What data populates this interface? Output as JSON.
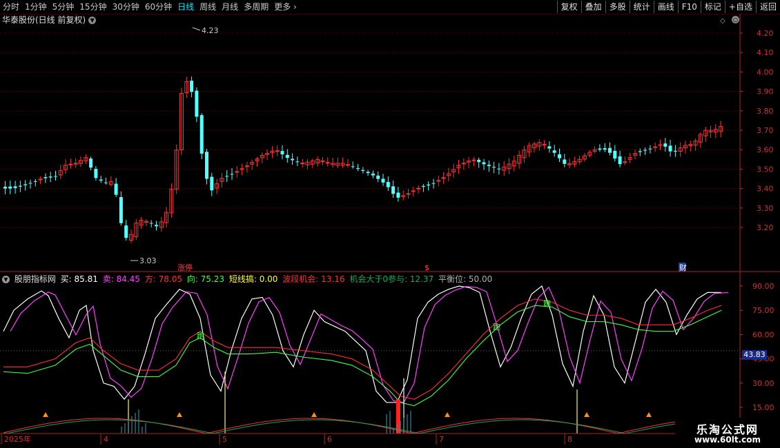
{
  "toolbar": {
    "periods": [
      "分时",
      "1分钟",
      "5分钟",
      "15分钟",
      "30分钟",
      "60分钟",
      "日线",
      "周线",
      "月线",
      "多周期",
      "更多"
    ],
    "active_period": "日线",
    "more_chevron": "›",
    "buttons": [
      "复权",
      "叠加",
      "多股",
      "统计",
      "画线",
      "F10",
      "标记",
      "+自选",
      "返回"
    ]
  },
  "main_chart": {
    "title": "华泰股份(日线 前复权)",
    "y_ticks": [
      "4.20",
      "4.10",
      "4.00",
      "3.90",
      "3.80",
      "3.70",
      "3.60",
      "3.50",
      "3.40",
      "3.30",
      "3.20"
    ],
    "high_label": "4.23",
    "low_label": "3.03",
    "event_markers": [
      "涨停",
      "$",
      "财"
    ],
    "colors": {
      "up": "#ff3232",
      "down": "#54ffff",
      "grid": "#5a0a0a",
      "axis": "#d03030"
    }
  },
  "indicator": {
    "name": "股朋指标网",
    "fields": [
      {
        "label": "买: 85.81",
        "color": "#ffffff"
      },
      {
        "label": "卖: 84.45",
        "color": "#ff40ff"
      },
      {
        "label": "方: 78.05",
        "color": "#ff3030"
      },
      {
        "label": "向: 75.23",
        "color": "#40ff40"
      },
      {
        "label": "短线搞: 0.00",
        "color": "#ffff30"
      },
      {
        "label": "波段机会: 13.16",
        "color": "#ff3030"
      },
      {
        "label": "机会大于0参与: 12.37",
        "color": "#18a860"
      },
      {
        "label": "平衡位: 50.00",
        "color": "#b0b0b0"
      }
    ],
    "y_ticks": [
      "90.00",
      "75.00",
      "60.00",
      "45.00",
      "30.00",
      "15.00"
    ],
    "current_value": "43.83",
    "run_marker": "跑"
  },
  "x_axis": {
    "labels": [
      "2025年",
      "4",
      "5",
      "6",
      "7",
      "8"
    ]
  },
  "watermark": {
    "title": "乐淘公式网",
    "url": "www.60lt.com"
  }
}
